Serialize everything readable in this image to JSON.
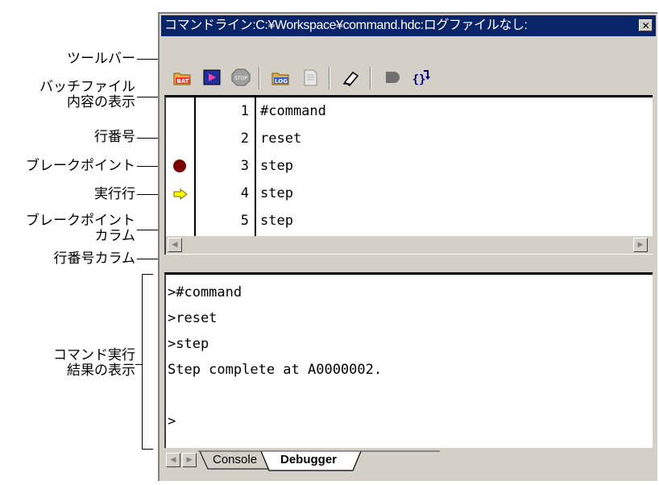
{
  "window": {
    "title": "コマンドライン:C:¥Workspace¥command.hdc:ログファイルなし:",
    "close_glyph": "✕"
  },
  "annotations": {
    "toolbar": "ツールバー",
    "batch_content_line1": "バッチファイル",
    "batch_content_line2": "内容の表示",
    "line_number": "行番号",
    "breakpoint": "ブレークポイント",
    "exec_line": "実行行",
    "bp_column_line1": "ブレークポイント",
    "bp_column_line2": "カラム",
    "line_number_column": "行番号カラム",
    "result_line1": "コマンド実行",
    "result_line2": "結果の表示"
  },
  "toolbar_buttons": [
    {
      "icon": "batch-open-icon",
      "label": "BAT"
    },
    {
      "icon": "run-batch-icon"
    },
    {
      "icon": "stop-icon",
      "label": "STOP"
    },
    {
      "icon": "log-open-icon",
      "label": "LOG"
    },
    {
      "icon": "log-file-icon"
    },
    {
      "icon": "eraser-icon"
    },
    {
      "icon": "record-icon"
    },
    {
      "icon": "step-into-icon",
      "label": "{}"
    }
  ],
  "batch": {
    "lines": [
      {
        "num": "1",
        "code": "#command",
        "breakpoint": false,
        "current": false
      },
      {
        "num": "2",
        "code": "reset",
        "breakpoint": false,
        "current": false
      },
      {
        "num": "3",
        "code": "step",
        "breakpoint": true,
        "current": false
      },
      {
        "num": "4",
        "code": "step",
        "breakpoint": false,
        "current": true
      },
      {
        "num": "5",
        "code": "step",
        "breakpoint": false,
        "current": false
      }
    ]
  },
  "console": {
    "lines": [
      ">#command",
      ">reset",
      ">step",
      "Step complete at A0000002.",
      "",
      ">"
    ]
  },
  "tabs": [
    {
      "label": "Console",
      "active": false
    },
    {
      "label": "Debugger",
      "active": true
    }
  ],
  "colors": {
    "titlebar": "#0a246a",
    "breakpoint": "#7a0000",
    "current_arrow": "#ffff00"
  }
}
